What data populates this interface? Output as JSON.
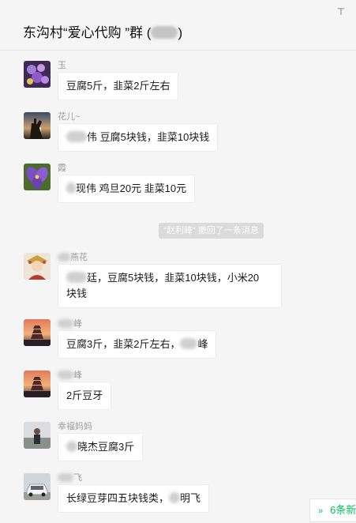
{
  "header": {
    "title_prefix": "东沟村“爱心代购 ”群 (",
    "title_suffix": ")",
    "pin_icon": "⊤"
  },
  "messages": [
    {
      "nick": "玉",
      "text": "豆腐5斤，韭菜2斤左右",
      "avatar": "purple-flowers"
    },
    {
      "nick": "花儿~",
      "text": "伟  豆腐5块钱，韭菜10块钱",
      "avatar": "hand-sunset"
    },
    {
      "nick": "霞",
      "text": "现伟  鸡旦20元    韭菜10元",
      "avatar": "purple-flower"
    },
    {
      "nick": "燕花",
      "text_line1": "廷，豆腐5块钱，韭菜10块钱，小米20",
      "text_line2": "块钱",
      "avatar": "costume-portrait"
    },
    {
      "nick": "峰",
      "text_main": "豆腐3斤，韭菜2斤左右，",
      "text_tail": "峰",
      "avatar": "pagoda-sunset"
    },
    {
      "nick": "峰",
      "text": "2斤豆牙",
      "avatar": "pagoda-sunset"
    },
    {
      "nick": "幸福妈妈",
      "text": "晓杰豆腐3斤",
      "avatar": "person-outdoor"
    },
    {
      "nick": "飞",
      "text_main": "长绿豆芽四五块钱类，",
      "text_tail": "明飞",
      "avatar": "white-car"
    }
  ],
  "system_notice": "\"赵利峰\" 撤回了一条消息",
  "new_messages": {
    "chevron": "»",
    "label": "6条新"
  },
  "colors": {
    "background": "#f5f5f5",
    "accent": "#07c160",
    "bubble": "#ffffff"
  }
}
